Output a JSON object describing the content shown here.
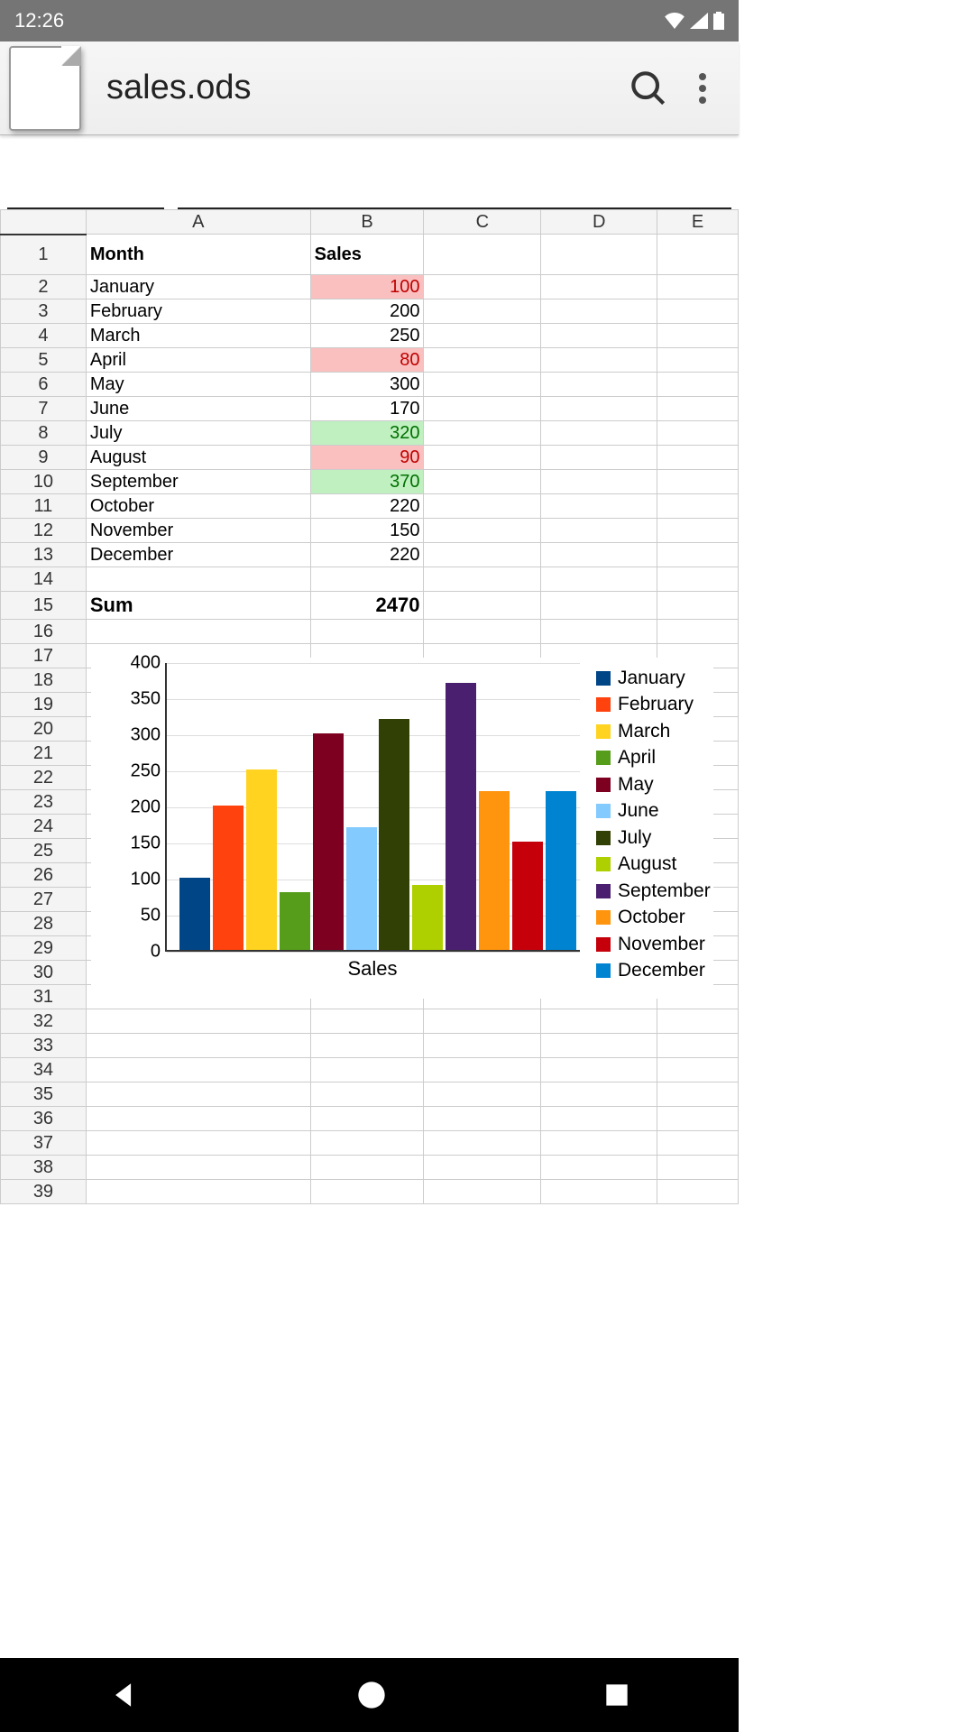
{
  "status": {
    "time": "12:26"
  },
  "app": {
    "title": "sales.ods"
  },
  "columns": [
    "A",
    "B",
    "C",
    "D",
    "E"
  ],
  "sheet": {
    "header": {
      "A": "Month",
      "B": "Sales"
    },
    "rows": [
      {
        "n": 1
      },
      {
        "n": 2,
        "A": "January",
        "B": "100",
        "cls": "hl-red"
      },
      {
        "n": 3,
        "A": "February",
        "B": "200"
      },
      {
        "n": 4,
        "A": "March",
        "B": "250"
      },
      {
        "n": 5,
        "A": "April",
        "B": "80",
        "cls": "hl-red"
      },
      {
        "n": 6,
        "A": "May",
        "B": "300"
      },
      {
        "n": 7,
        "A": "June",
        "B": "170"
      },
      {
        "n": 8,
        "A": "July",
        "B": "320",
        "cls": "hl-green"
      },
      {
        "n": 9,
        "A": "August",
        "B": "90",
        "cls": "hl-red"
      },
      {
        "n": 10,
        "A": "September",
        "B": "370",
        "cls": "hl-green"
      },
      {
        "n": 11,
        "A": "October",
        "B": "220"
      },
      {
        "n": 12,
        "A": "November",
        "B": "150"
      },
      {
        "n": 13,
        "A": "December",
        "B": "220"
      },
      {
        "n": 14
      },
      {
        "n": 15,
        "A": "Sum",
        "B": "2470",
        "sum": true
      }
    ],
    "emptyFrom": 16,
    "emptyTo": 39
  },
  "chart_data": {
    "type": "bar",
    "xlabel": "Sales",
    "ylim": [
      0,
      400
    ],
    "yticks": [
      0,
      50,
      100,
      150,
      200,
      250,
      300,
      350,
      400
    ],
    "series": [
      {
        "name": "January",
        "value": 100,
        "color": "#004586"
      },
      {
        "name": "February",
        "value": 200,
        "color": "#ff420e"
      },
      {
        "name": "March",
        "value": 250,
        "color": "#ffd320"
      },
      {
        "name": "April",
        "value": 80,
        "color": "#579d1c"
      },
      {
        "name": "May",
        "value": 300,
        "color": "#7e0021"
      },
      {
        "name": "June",
        "value": 170,
        "color": "#83caff"
      },
      {
        "name": "July",
        "value": 320,
        "color": "#314004"
      },
      {
        "name": "August",
        "value": 90,
        "color": "#aecf00"
      },
      {
        "name": "September",
        "value": 370,
        "color": "#4b1f6f"
      },
      {
        "name": "October",
        "value": 220,
        "color": "#ff950e"
      },
      {
        "name": "November",
        "value": 150,
        "color": "#c5000b"
      },
      {
        "name": "December",
        "value": 220,
        "color": "#0084d1"
      }
    ]
  }
}
